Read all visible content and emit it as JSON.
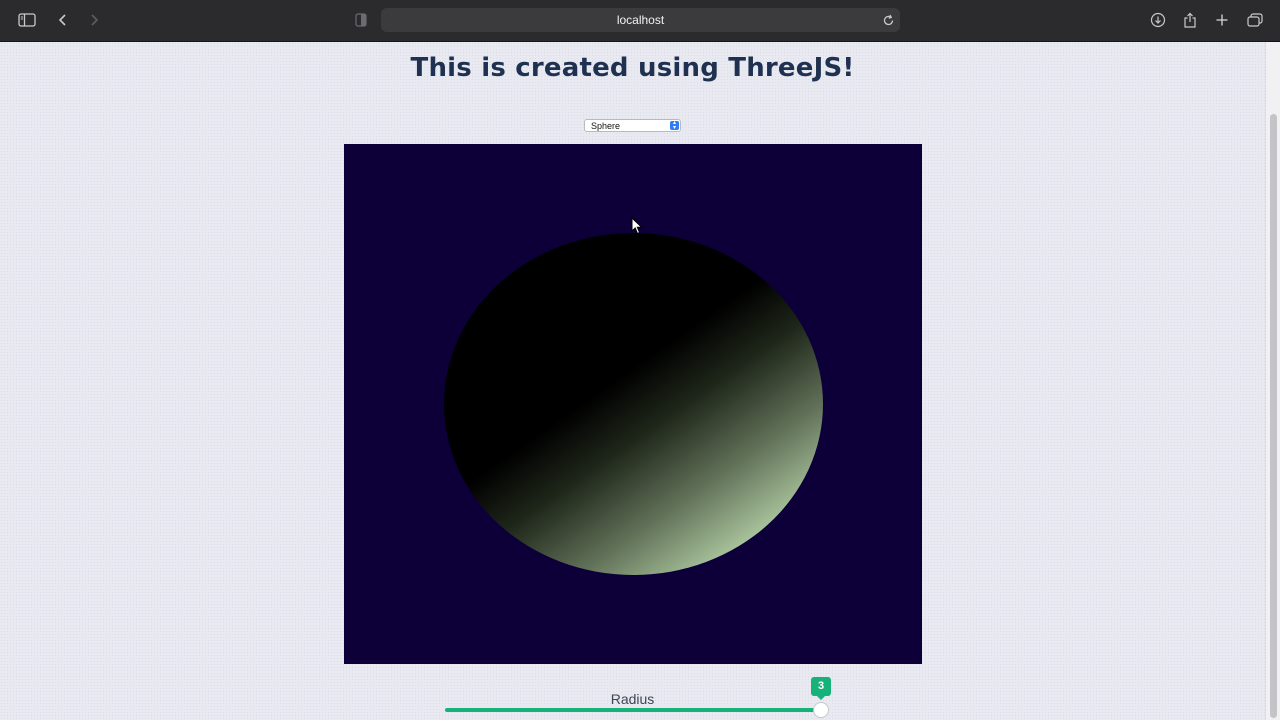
{
  "browser": {
    "address": "localhost",
    "icons": {
      "sidebar": "sidebar-icon",
      "back": "back-arrow-icon",
      "forward": "forward-arrow-icon",
      "shield": "privacy-shield-icon",
      "reload": "reload-icon",
      "download": "download-icon",
      "share": "share-icon",
      "new_tab": "plus-icon",
      "tabs": "tab-overview-icon"
    }
  },
  "page": {
    "title": "This is created using ThreeJS!",
    "shape_select": {
      "selected": "Sphere"
    },
    "scene": {
      "background_color": "#0d0039",
      "object": "sphere"
    },
    "slider": {
      "label": "Radius",
      "value": "3",
      "fill_fraction": 1.0,
      "accent_color": "#16b27a"
    }
  }
}
